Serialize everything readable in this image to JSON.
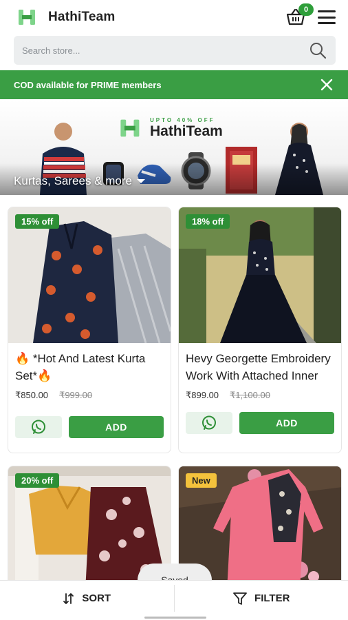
{
  "header": {
    "brand": "HathiTeam",
    "cart_count": "0"
  },
  "search": {
    "placeholder": "Search store..."
  },
  "cod_banner": {
    "text": "COD available for PRIME members"
  },
  "hero": {
    "tag": "UPTO 40% OFF",
    "brand": "HathiTeam",
    "caption": "Kurtas, Sarees & more"
  },
  "products": [
    {
      "badge": "15% off",
      "title": "🔥 *Hot And Latest Kurta Set*🔥",
      "price": "₹850.00",
      "mrp": "₹999.00",
      "add_label": "ADD"
    },
    {
      "badge": "18% off",
      "title": "Hevy Georgette Embroidery Work With Attached Inner",
      "price": "₹899.00",
      "mrp": "₹1,100.00",
      "add_label": "ADD"
    },
    {
      "badge": "20% off"
    },
    {
      "badge": "New"
    }
  ],
  "bottom_bar": {
    "sort": "SORT",
    "filter": "FILTER"
  },
  "toast": {
    "text": "Saved"
  },
  "colors": {
    "brand_green": "#3a9e44",
    "badge_new": "#f4c23c"
  }
}
